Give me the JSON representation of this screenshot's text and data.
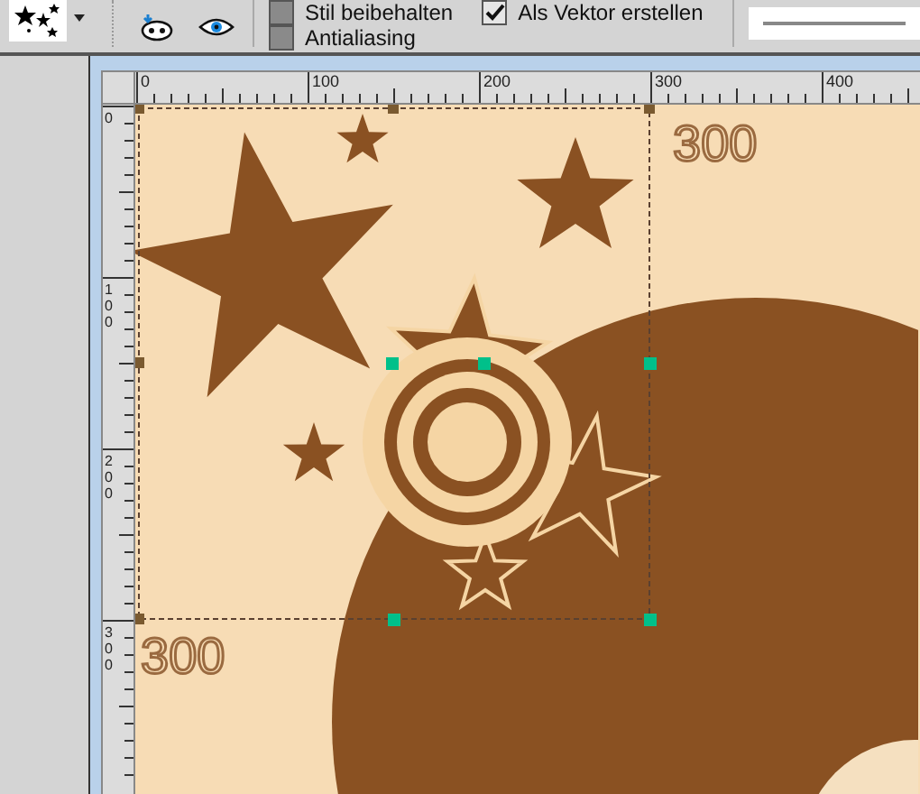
{
  "toolbar": {
    "options": [
      {
        "label": "Stil beibehalten",
        "checked": false
      },
      {
        "label": "Antialiasing",
        "checked": false
      },
      {
        "label": "Als Vektor erstellen",
        "checked": true
      }
    ]
  },
  "rulers": {
    "horizontal": [
      "0",
      "100",
      "200",
      "300",
      "400"
    ],
    "vertical": [
      "0",
      "100",
      "200",
      "300"
    ]
  },
  "canvas": {
    "labels": [
      "300",
      "300"
    ]
  }
}
